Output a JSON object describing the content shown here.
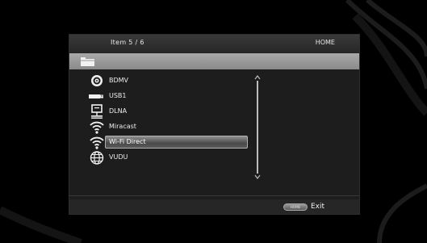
{
  "header": {
    "item_counter": "Item 5 / 6",
    "home_label": "HOME"
  },
  "path_bar": {
    "icon": "folder-icon"
  },
  "list": {
    "items": [
      {
        "label": "BDMV",
        "icon": "disc-icon",
        "selected": false
      },
      {
        "label": "USB1",
        "icon": "usb-icon",
        "selected": false
      },
      {
        "label": "DLNA",
        "icon": "dlna-server-icon",
        "selected": false
      },
      {
        "label": "Miracast",
        "icon": "wireless-icon",
        "selected": false
      },
      {
        "label": "Wi-Fi Direct",
        "icon": "wireless-icon",
        "selected": true
      },
      {
        "label": "VUDU",
        "icon": "globe-icon",
        "selected": false
      }
    ]
  },
  "footer": {
    "home_key_label": "HOME",
    "exit_label": "Exit"
  },
  "colors": {
    "background": "#000000",
    "panel": "#1d1d1d",
    "path_bar": "#a0a0a0",
    "selection": "#6a6a6a",
    "text": "#e6e6e6"
  }
}
